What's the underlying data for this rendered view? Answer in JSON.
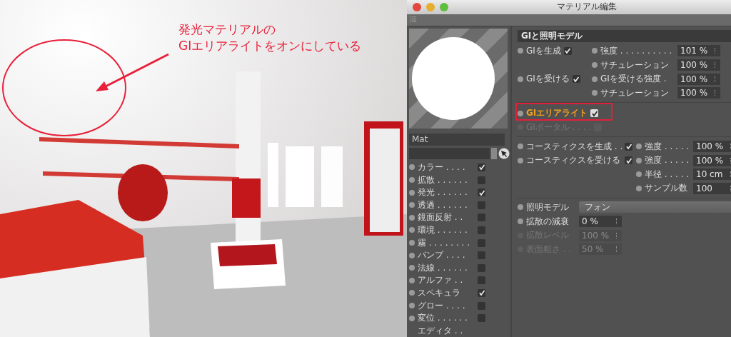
{
  "annotation": {
    "lines": [
      "発光マテリアルの",
      "GIエリアライトをオンにしている"
    ]
  },
  "window": {
    "title": "マテリアル編集"
  },
  "material": {
    "name": "Mat"
  },
  "channels": [
    {
      "label": "カラー . . . .",
      "checked": true
    },
    {
      "label": "拡散 . . . . . .",
      "checked": false
    },
    {
      "label": "発光 . . . . . .",
      "checked": true
    },
    {
      "label": "透過 . . . . . .",
      "checked": false
    },
    {
      "label": "鏡面反射 . .",
      "checked": false
    },
    {
      "label": "環境 . . . . . .",
      "checked": false
    },
    {
      "label": "霧 . . . . . . . .",
      "checked": false
    },
    {
      "label": "バンプ . . . .",
      "checked": false
    },
    {
      "label": "法線 . . . . . .",
      "checked": false
    },
    {
      "label": "アルファ . .",
      "checked": false
    },
    {
      "label": "スペキュラ",
      "checked": true
    },
    {
      "label": "グロー . . . .",
      "checked": false
    },
    {
      "label": "変位 . . . . . .",
      "checked": false
    }
  ],
  "channels_more": "エディタ . .",
  "gi": {
    "header": "GIと照明モデル",
    "toggles": [
      {
        "label": "GIを生成",
        "checked": true
      },
      {
        "label": "GIを受ける",
        "checked": true
      }
    ],
    "values": [
      {
        "label": "強度 . . . . . . . . . .",
        "value": "101 %"
      },
      {
        "label": "サチュレーション",
        "value": "100 %"
      },
      {
        "label": "GIを受ける強度 .",
        "value": "100 %"
      },
      {
        "label": "サチュレーション",
        "value": "100 %"
      }
    ]
  },
  "area_light": {
    "label": "GIエリアライト",
    "checked": true,
    "highlighted": true
  },
  "portal": {
    "label": "GIポータル . . . .",
    "checked": false,
    "disabled": true
  },
  "caustics": {
    "toggles": [
      {
        "label": "コースティクスを生成 . .",
        "checked": true
      },
      {
        "label": "コースティクスを受ける",
        "checked": true
      }
    ],
    "values": [
      {
        "label": "強度 . . . . .",
        "value": "100 %"
      },
      {
        "label": "強度 . . . . .",
        "value": "100 %"
      },
      {
        "label": "半径 . . . . .",
        "value": "10 cm"
      },
      {
        "label": "サンプル数",
        "value": "100"
      }
    ]
  },
  "illumination": {
    "model_label": "照明モデル",
    "model": "フォン",
    "fields": [
      {
        "label": "拡散の減衰",
        "value": "0 %",
        "disabled": false
      },
      {
        "label": "拡散レベル",
        "value": "100 %",
        "disabled": true
      },
      {
        "label": "表面粗さ . .",
        "value": "50 %",
        "disabled": true
      }
    ]
  }
}
